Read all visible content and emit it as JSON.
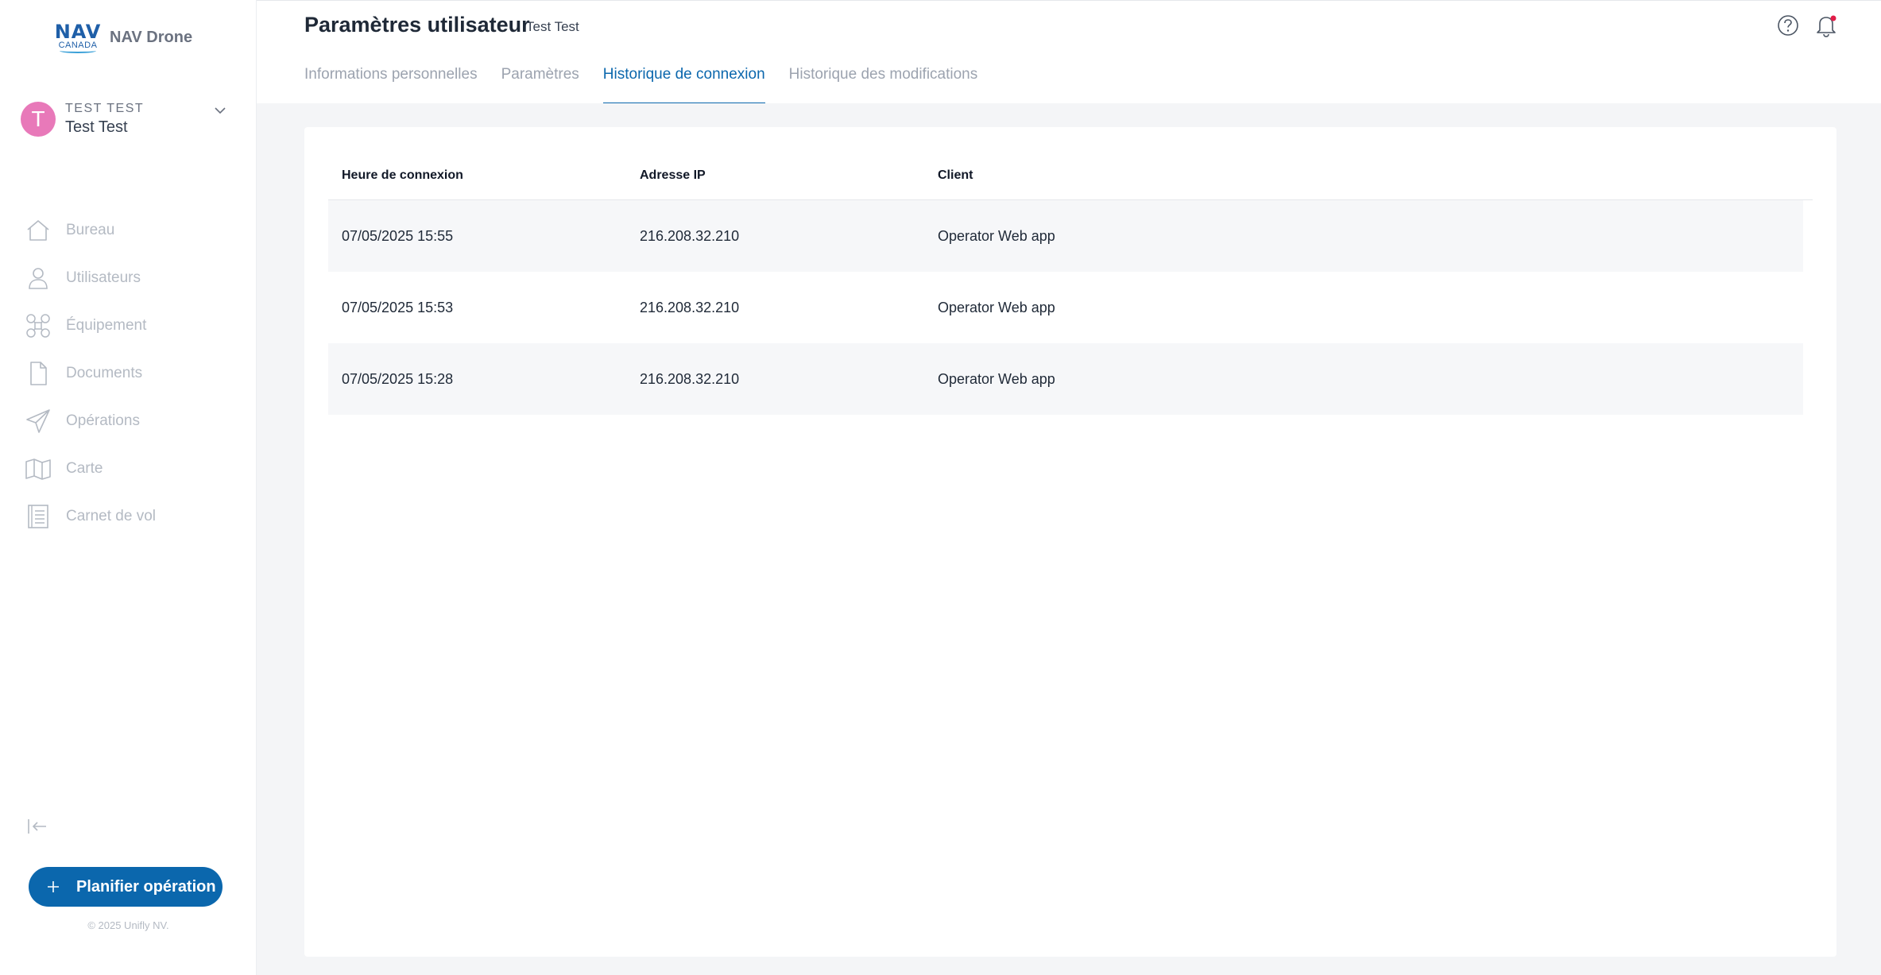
{
  "app": {
    "logo_mark": "NAV",
    "logo_sub": "CANADA",
    "name": "NAV Drone"
  },
  "user": {
    "initial": "T",
    "upper_name": "TEST TEST",
    "name": "Test Test"
  },
  "sidebar": {
    "items": [
      {
        "label": "Bureau",
        "icon": "home-icon"
      },
      {
        "label": "Utilisateurs",
        "icon": "user-icon"
      },
      {
        "label": "Équipement",
        "icon": "drone-icon"
      },
      {
        "label": "Documents",
        "icon": "document-icon"
      },
      {
        "label": "Opérations",
        "icon": "paper-plane-icon"
      },
      {
        "label": "Carte",
        "icon": "map-icon"
      },
      {
        "label": "Carnet de vol",
        "icon": "logbook-icon"
      }
    ],
    "plan_button": "Planifier opération",
    "copyright": "© 2025 Unifly NV."
  },
  "header": {
    "title": "Paramètres utilisateur",
    "subtitle": "Test Test",
    "tabs": [
      {
        "label": "Informations personnelles",
        "active": false
      },
      {
        "label": "Paramètres",
        "active": false
      },
      {
        "label": "Historique de connexion",
        "active": true
      },
      {
        "label": "Historique des modifications",
        "active": false
      }
    ]
  },
  "table": {
    "columns": [
      "Heure de connexion",
      "Adresse IP",
      "Client"
    ],
    "rows": [
      [
        "07/05/2025 15:55",
        "216.208.32.210",
        "Operator Web app"
      ],
      [
        "07/05/2025 15:53",
        "216.208.32.210",
        "Operator Web app"
      ],
      [
        "07/05/2025 15:28",
        "216.208.32.210",
        "Operator Web app"
      ]
    ]
  },
  "colors": {
    "accent": "#0b67ad",
    "avatar": "#e879b9",
    "notification_dot": "#e11d48",
    "sidebar_text": "#b4bac3"
  }
}
